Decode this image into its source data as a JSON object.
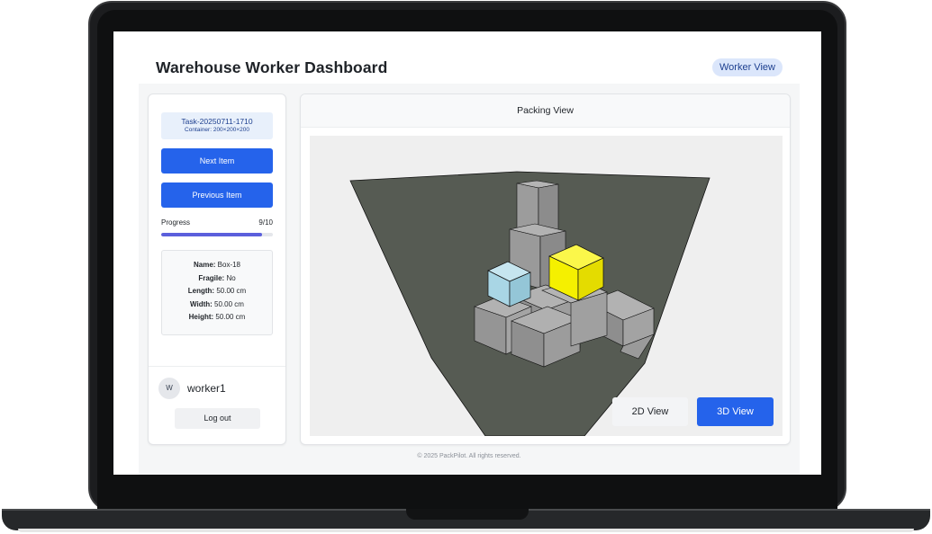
{
  "header": {
    "title": "Warehouse Worker Dashboard",
    "role_badge": "Worker View"
  },
  "task": {
    "id": "Task-20250711-1710",
    "container": "Container: 200×200×200"
  },
  "actions": {
    "next_label": "Next Item",
    "previous_label": "Previous Item"
  },
  "progress": {
    "label": "Progress",
    "count": "9/10",
    "fraction": 0.9
  },
  "item_details": {
    "name_label": "Name:",
    "name_value": " Box-18",
    "fragile_label": "Fragile:",
    "fragile_value": " No",
    "length_label": "Length:",
    "length_value": " 50.00 cm",
    "width_label": "Width:",
    "width_value": " 50.00 cm",
    "height_label": "Height:",
    "height_value": " 50.00 cm"
  },
  "user": {
    "avatar_initial": "W",
    "username": "worker1",
    "logout_label": "Log out"
  },
  "packing_view": {
    "title": "Packing View",
    "view_2d_label": "2D View",
    "view_3d_label": "3D View",
    "active_view": "3D View"
  },
  "colors": {
    "accent": "#2563eb",
    "progress_fill": "#5b5fdc",
    "floor": "#565b53",
    "box_gray": "#9a9a9a",
    "box_highlight_yellow": "#f5f000",
    "box_highlight_blue": "#a9d6e5"
  },
  "footer": {
    "text": "© 2025 PackPilot. All rights reserved."
  }
}
